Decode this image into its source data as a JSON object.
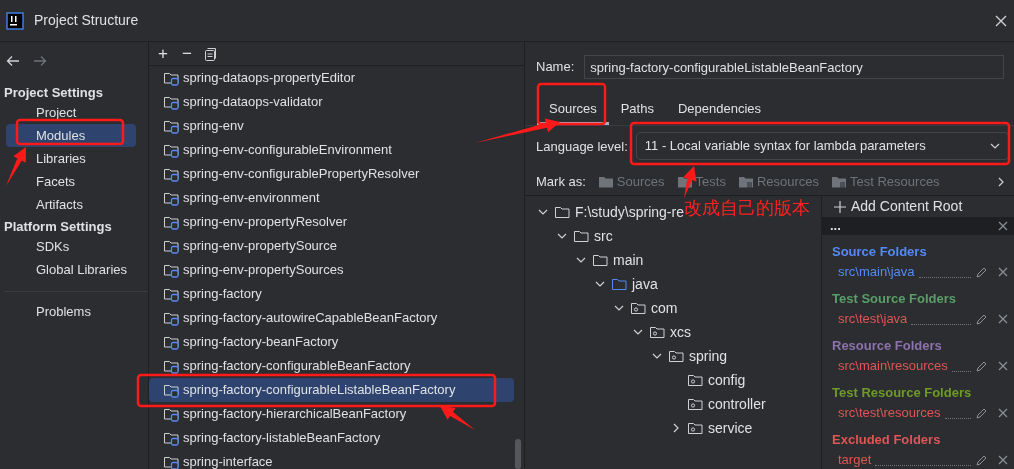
{
  "window": {
    "title": "Project Structure"
  },
  "sidebar": {
    "sections": [
      {
        "title": "Project Settings",
        "items": [
          {
            "label": "Project",
            "selected": false
          },
          {
            "label": "Modules",
            "selected": true
          },
          {
            "label": "Libraries",
            "selected": false
          },
          {
            "label": "Facets",
            "selected": false
          },
          {
            "label": "Artifacts",
            "selected": false
          }
        ]
      },
      {
        "title": "Platform Settings",
        "items": [
          {
            "label": "SDKs",
            "selected": false
          },
          {
            "label": "Global Libraries",
            "selected": false
          }
        ]
      }
    ],
    "footer_items": [
      {
        "label": "Problems",
        "selected": false
      }
    ]
  },
  "modules": {
    "toolbar": [
      "+",
      "−"
    ],
    "items": [
      {
        "label": "spring-dataops-propertyEditor",
        "selected": false
      },
      {
        "label": "spring-dataops-validator",
        "selected": false
      },
      {
        "label": "spring-env",
        "selected": false
      },
      {
        "label": "spring-env-configurableEnvironment",
        "selected": false
      },
      {
        "label": "spring-env-configurablePropertyResolver",
        "selected": false
      },
      {
        "label": "spring-env-environment",
        "selected": false
      },
      {
        "label": "spring-env-propertyResolver",
        "selected": false
      },
      {
        "label": "spring-env-propertySource",
        "selected": false
      },
      {
        "label": "spring-env-propertySources",
        "selected": false
      },
      {
        "label": "spring-factory",
        "selected": false
      },
      {
        "label": "spring-factory-autowireCapableBeanFactory",
        "selected": false
      },
      {
        "label": "spring-factory-beanFactory",
        "selected": false
      },
      {
        "label": "spring-factory-configurableBeanFactory",
        "selected": false
      },
      {
        "label": "spring-factory-configurableListableBeanFactory",
        "selected": true
      },
      {
        "label": "spring-factory-hierarchicalBeanFactory",
        "selected": false
      },
      {
        "label": "spring-factory-listableBeanFactory",
        "selected": false
      },
      {
        "label": "spring-interface",
        "selected": false
      }
    ]
  },
  "details": {
    "name_label": "Name:",
    "name_value": "spring-factory-configurableListableBeanFactory",
    "tabs": [
      {
        "label": "Sources",
        "selected": true
      },
      {
        "label": "Paths",
        "selected": false
      },
      {
        "label": "Dependencies",
        "selected": false
      }
    ],
    "language_level": {
      "label": "Language level:",
      "value": "11 - Local variable syntax for lambda parameters"
    },
    "mark_as": {
      "label": "Mark as:",
      "buttons": [
        {
          "label": "Sources",
          "kind": "sources",
          "disabled": true
        },
        {
          "label": "Tests",
          "kind": "tests",
          "disabled": true
        },
        {
          "label": "Resources",
          "kind": "resources",
          "disabled": true
        },
        {
          "label": "Test Resources",
          "kind": "test-resources",
          "disabled": true
        }
      ]
    },
    "tree": [
      {
        "label": "F:\\study\\spring-re",
        "kind": "folder",
        "expanded": true,
        "children": [
          {
            "label": "src",
            "kind": "folder",
            "expanded": true,
            "children": [
              {
                "label": "main",
                "kind": "folder",
                "expanded": true,
                "children": [
                  {
                    "label": "java",
                    "kind": "source",
                    "expanded": true,
                    "children": [
                      {
                        "label": "com",
                        "kind": "package",
                        "expanded": true,
                        "children": [
                          {
                            "label": "xcs",
                            "kind": "package",
                            "expanded": true,
                            "children": [
                              {
                                "label": "spring",
                                "kind": "package",
                                "expanded": true,
                                "children": [
                                  {
                                    "label": "config",
                                    "kind": "package"
                                  },
                                  {
                                    "label": "controller",
                                    "kind": "package"
                                  },
                                  {
                                    "label": "service",
                                    "kind": "package",
                                    "expanded": false
                                  }
                                ]
                              }
                            ]
                          }
                        ]
                      }
                    ]
                  }
                ]
              }
            ]
          }
        ]
      }
    ],
    "content_root": {
      "add_label": "Add Content Root",
      "header": "...",
      "groups": [
        {
          "title": {
            "text": "Source Folders",
            "color": "#548af7"
          },
          "path": {
            "text": "src\\main\\java",
            "color": "#548af7"
          }
        },
        {
          "title": {
            "text": "Test Source Folders",
            "color": "#5a9e68"
          },
          "path": {
            "text": "src\\test\\java",
            "color": "#e05555"
          }
        },
        {
          "title": {
            "text": "Resource Folders",
            "color": "#8d72ad"
          },
          "path": {
            "text": "src\\main\\resources",
            "color": "#e05555"
          }
        },
        {
          "title": {
            "text": "Test Resource Folders",
            "color": "#6e9a2a"
          },
          "path": {
            "text": "src\\test\\resources",
            "color": "#e05555"
          }
        },
        {
          "title": {
            "text": "Excluded Folders",
            "color": "#e05555"
          },
          "path": {
            "text": "target",
            "color": "#e05555"
          }
        }
      ]
    }
  },
  "annotation": {
    "text": "改成自己的版本"
  }
}
